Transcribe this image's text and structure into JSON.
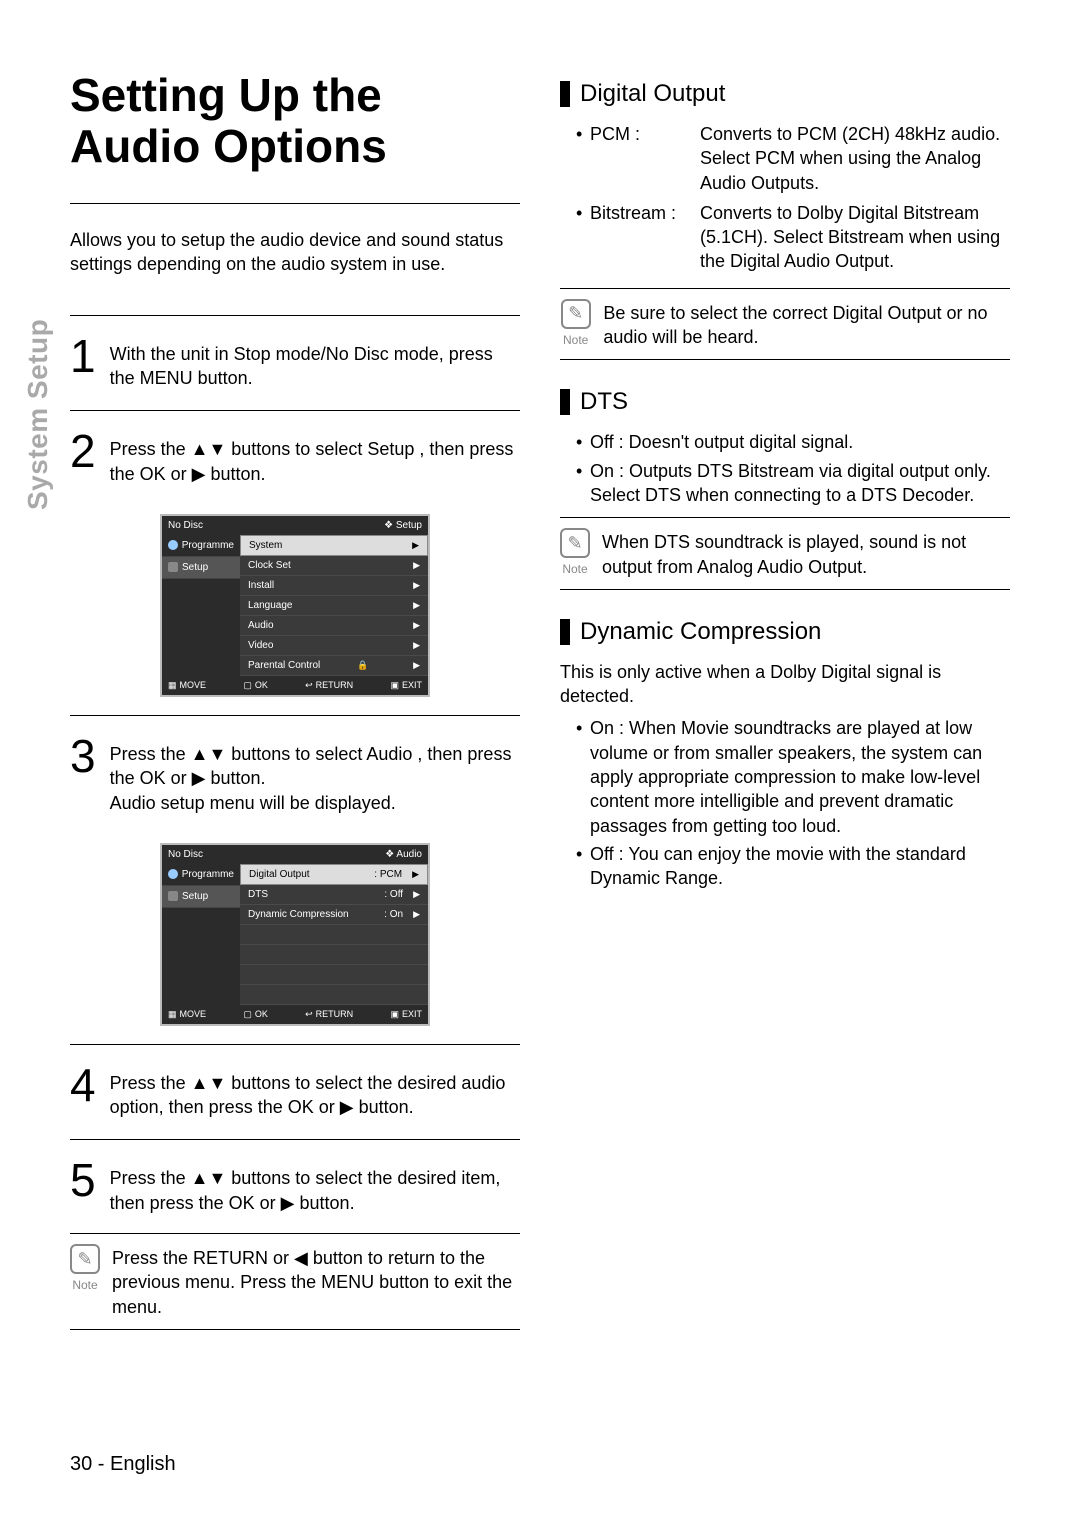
{
  "side_label": "System Setup",
  "left": {
    "title": "Setting Up the Audio Options",
    "intro": "Allows you to setup the audio device and sound status settings depending on the audio system in use.",
    "steps": [
      {
        "num": "1",
        "text": "With the unit in Stop mode/No Disc mode, press the MENU button."
      },
      {
        "num": "2",
        "text": "Press the ▲▼ buttons to select Setup , then press the OK or ▶ button."
      },
      {
        "num": "3",
        "text": "Press the ▲▼ buttons to select Audio , then press the  OK or ▶ button.\nAudio setup menu will be displayed."
      },
      {
        "num": "4",
        "text": "Press the ▲▼ buttons to select the desired audio option, then press the OK or ▶ button."
      },
      {
        "num": "5",
        "text": "Press the ▲▼ buttons to select the desired item, then press the OK or ▶ button."
      }
    ],
    "note_label": "Note",
    "note_text": "Press the RETURN or ◀ button to return to the previous menu. Press the MENU button to exit the menu.",
    "osd1": {
      "top_left": "No Disc",
      "top_right": "❖ Setup",
      "side": [
        {
          "label": "Programme",
          "icon": "dot"
        },
        {
          "label": "Setup",
          "icon": "gear",
          "selected": true
        }
      ],
      "rows": [
        {
          "label": "System",
          "selected": true
        },
        {
          "label": "Clock Set"
        },
        {
          "label": "Install"
        },
        {
          "label": "Language"
        },
        {
          "label": "Audio"
        },
        {
          "label": "Video"
        },
        {
          "label": "Parental Control",
          "lock": true
        }
      ],
      "bottom": {
        "move": "MOVE",
        "ok": "OK",
        "return": "RETURN",
        "exit": "EXIT"
      }
    },
    "osd2": {
      "top_left": "No Disc",
      "top_right": "❖ Audio",
      "side": [
        {
          "label": "Programme",
          "icon": "dot"
        },
        {
          "label": "Setup",
          "icon": "gear",
          "selected": true
        }
      ],
      "rows": [
        {
          "label": "Digital Output",
          "value": ": PCM",
          "selected": true
        },
        {
          "label": "DTS",
          "value": ": Off"
        },
        {
          "label": "Dynamic Compression",
          "value": ": On"
        }
      ],
      "bottom": {
        "move": "MOVE",
        "ok": "OK",
        "return": "RETURN",
        "exit": "EXIT"
      }
    }
  },
  "right": {
    "digital_output": {
      "title": "Digital Output",
      "items": [
        {
          "term": "PCM :",
          "desc": "Converts to PCM (2CH) 48kHz audio. Select PCM when using the Analog Audio Outputs."
        },
        {
          "term": "Bitstream  :",
          "desc": "Converts to Dolby Digital Bitstream (5.1CH). Select Bitstream when using the Digital Audio Output."
        }
      ],
      "note_label": "Note",
      "note_text": "Be sure to select the correct Digital Output or no audio will be heard."
    },
    "dts": {
      "title": "DTS",
      "items": [
        "Off : Doesn't output digital signal.",
        "On : Outputs DTS Bitstream via digital output only. Select DTS when connecting to a DTS Decoder."
      ],
      "note_label": "Note",
      "note_text": "When DTS soundtrack is played, sound is not output from Analog Audio Output."
    },
    "dyn": {
      "title": "Dynamic Compression",
      "intro": "This is only active when a Dolby Digital signal is detected.",
      "items": [
        "On : When Movie soundtracks are played at low volume or from smaller speakers, the system can apply appropriate compression to make low-level content more intelligible and prevent dramatic passages from getting too loud.",
        "Off : You can enjoy the movie with the standard Dynamic Range."
      ]
    }
  },
  "footer": "30 - English"
}
